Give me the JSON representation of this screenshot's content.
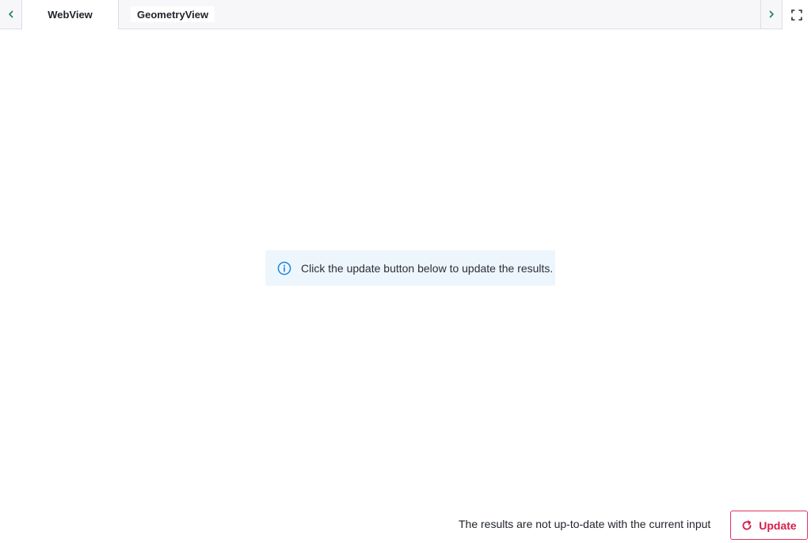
{
  "tabs": {
    "items": [
      {
        "label": "WebView",
        "active": true
      },
      {
        "label": "GeometryView",
        "active": false
      }
    ],
    "prev_icon": "chevron-left-icon",
    "next_icon": "chevron-right-icon",
    "fullscreen_icon": "expand-icon"
  },
  "info": {
    "icon": "info-icon",
    "message": "Click the update button below to update the results."
  },
  "footer": {
    "status_text": "The results are not up-to-date with the current input",
    "update_label": "Update",
    "update_icon": "refresh-icon"
  },
  "colors": {
    "accent_green": "#1a7f64",
    "info_blue": "#1a86d8",
    "update_red": "#d81e4a",
    "info_bg": "#eef6fd",
    "tabstrip_bg": "#f7f7fa"
  }
}
